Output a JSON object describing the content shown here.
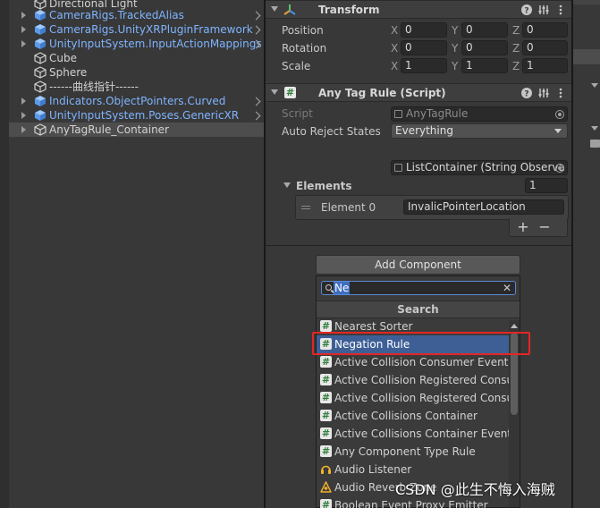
{
  "hierarchy": {
    "items": [
      {
        "label": "Directional Light",
        "type": "normal",
        "has_arrow": false
      },
      {
        "label": "CameraRigs.TrackedAlias",
        "type": "prefab",
        "has_arrow": true
      },
      {
        "label": "CameraRigs.UnityXRPluginFramework",
        "type": "prefab",
        "has_arrow": true
      },
      {
        "label": "UnityInputSystem.InputActionMappings",
        "type": "prefab",
        "has_arrow": true
      },
      {
        "label": "Cube",
        "type": "normal",
        "has_arrow": false
      },
      {
        "label": "Sphere",
        "type": "normal",
        "has_arrow": false
      },
      {
        "label": "------曲线指针------",
        "type": "normal",
        "has_arrow": false
      },
      {
        "label": "Indicators.ObjectPointers.Curved",
        "type": "prefab",
        "has_arrow": true
      },
      {
        "label": "UnityInputSystem.Poses.GenericXR",
        "type": "prefab",
        "has_arrow": true
      },
      {
        "label": "AnyTagRule_Container",
        "type": "normal",
        "has_arrow": true,
        "selected": true
      }
    ]
  },
  "inspector": {
    "transform": {
      "title": "Transform",
      "rows": [
        {
          "label": "Position",
          "x": "0",
          "y": "0",
          "z": "0"
        },
        {
          "label": "Rotation",
          "x": "0",
          "y": "0",
          "z": "0"
        },
        {
          "label": "Scale",
          "x": "1",
          "y": "1",
          "z": "1"
        }
      ],
      "axis_x": "X",
      "axis_y": "Y",
      "axis_z": "Z"
    },
    "any_tag_rule": {
      "title": "Any Tag Rule (Script)",
      "script_label": "Script",
      "script_value": "AnyTagRule",
      "auto_reject_label": "Auto Reject States",
      "auto_reject_value": "Everything",
      "list_container_value": "ListContainer (String Observa",
      "elements_label": "Elements",
      "elements_count": "1",
      "element0_label": "Element 0",
      "element0_value": "InvalicPointerLocation",
      "plus": "+",
      "minus": "−"
    },
    "add_component": {
      "button_label": "Add Component",
      "search_value": "Ne",
      "clear_symbol": "✕",
      "popup_title": "Search",
      "results": [
        {
          "label": "Nearest Sorter",
          "icon": "script-icon"
        },
        {
          "label": "Negation Rule",
          "icon": "script-icon",
          "selected": true
        },
        {
          "label": "Active Collision Consumer Event Co",
          "icon": "script-icon"
        },
        {
          "label": "Active Collision Registered Consum",
          "icon": "script-icon"
        },
        {
          "label": "Active Collision Registered Consum",
          "icon": "script-icon"
        },
        {
          "label": "Active Collisions Container",
          "icon": "script-icon"
        },
        {
          "label": "Active Collisions Container Event P",
          "icon": "script-icon"
        },
        {
          "label": "Any Component Type Rule",
          "icon": "script-icon"
        },
        {
          "label": "Audio Listener",
          "icon": "headphones-icon"
        },
        {
          "label": "Audio Reverb Zone",
          "icon": "reverb-icon"
        },
        {
          "label": "Boolean Event Proxy Emitter",
          "icon": "script-icon"
        }
      ]
    }
  },
  "watermark": "CSDN @此生不悔入海贼",
  "colors": {
    "prefab_text": "#7fb4ff",
    "selection": "#3e5f96",
    "highlight_box": "#e32626",
    "script_icon_green": "#2f7d3a"
  }
}
